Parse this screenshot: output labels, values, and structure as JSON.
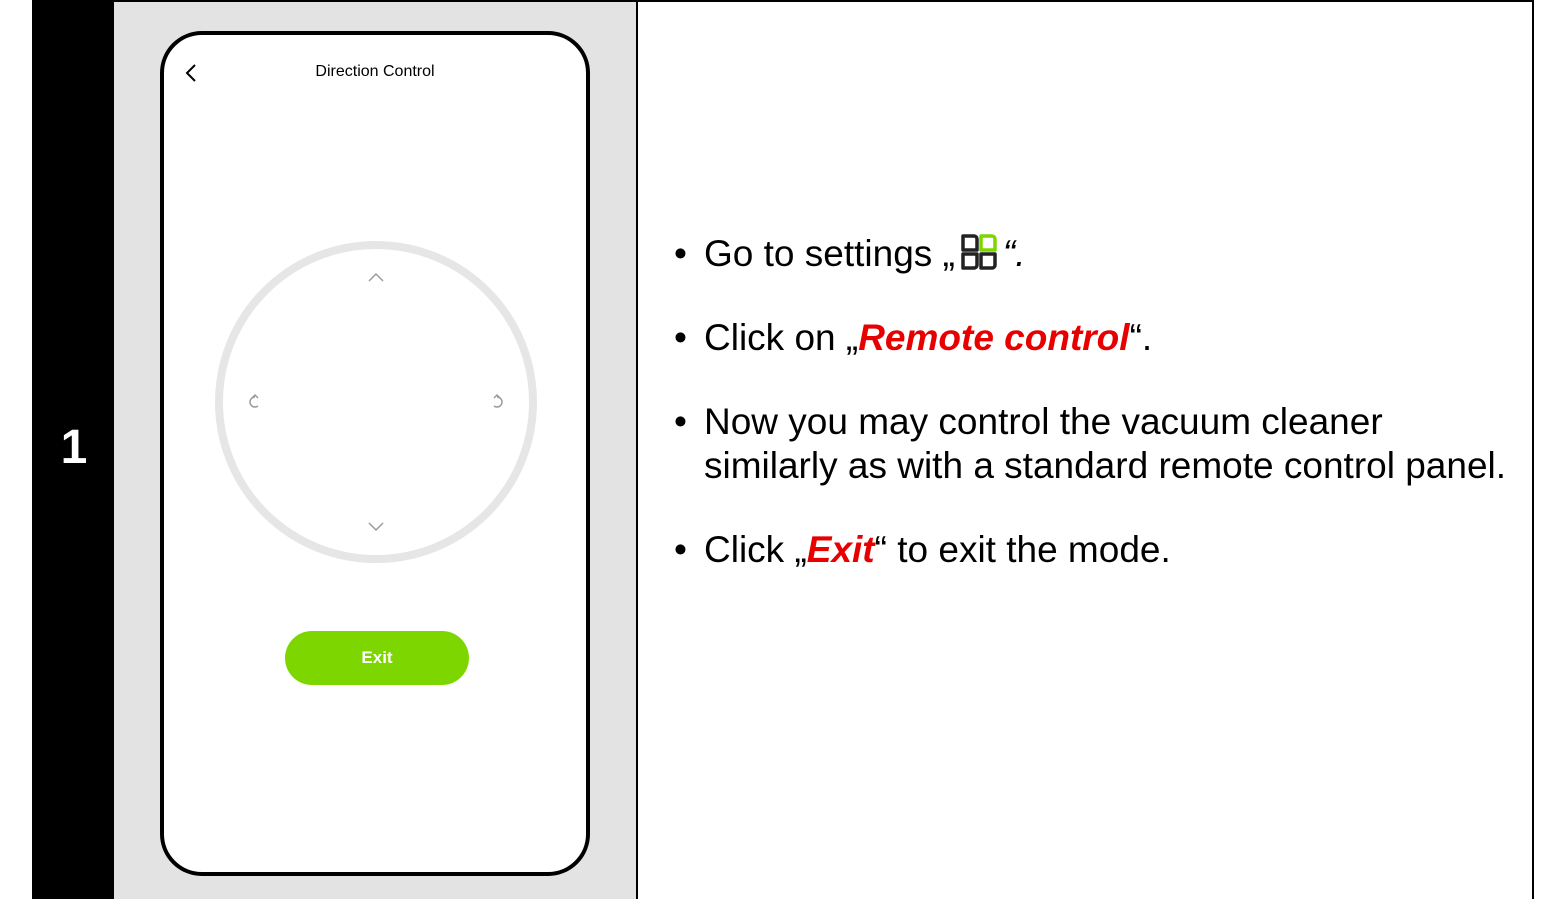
{
  "step": {
    "number": "1"
  },
  "phone": {
    "title": "Direction Control",
    "back_icon": "chevron-left-icon",
    "dial": {
      "icons": [
        "chevron-up-icon",
        "chevron-down-icon",
        "rotate-left-icon",
        "rotate-right-icon"
      ]
    },
    "exit_label": "Exit",
    "colors": {
      "exit_button": "#7ed600",
      "dial_ring": "#e6e6e6"
    }
  },
  "instructions": {
    "bullet": "•",
    "items": [
      {
        "before": "Go to settings „",
        "icon": "settings-grid-icon",
        "after": "“."
      },
      {
        "before": "Click on „",
        "highlight": "Remote control",
        "after": "“."
      },
      {
        "text": "Now you may control the vacuum cleaner similarly as with a standard remote control panel."
      },
      {
        "before": "Click „",
        "highlight": "Exit",
        "after": "“ to exit the mode."
      }
    ],
    "colors": {
      "highlight": "#e80000",
      "icon_dark": "#222222",
      "icon_green": "#7ed600"
    }
  }
}
